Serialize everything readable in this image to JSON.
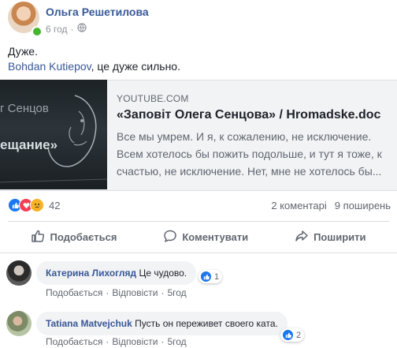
{
  "post": {
    "author": "Ольга Решетилова",
    "time": "6 год",
    "line1": "Дуже.",
    "mention": "Bohdan Kutiepov",
    "line2_rest": ", це дуже сильно."
  },
  "link_card": {
    "source": "YOUTUBE.COM",
    "title": "«Заповіт Олега Сенцова» / Hromadske.doc",
    "description": "Все мы умрем. И я, к сожалению, не исключение. Всем хотелось бы пожить подольше, и тут я тоже, к счастью, не исключение. Нет, мне не хотелось бы...",
    "thumb_line1": "г Сенцов",
    "thumb_line2": "ещание»"
  },
  "reactions": {
    "count": "42",
    "comments": "2 коментарі",
    "shares": "9 поширень",
    "icons": [
      "like-icon",
      "love-icon",
      "sad-icon"
    ]
  },
  "actions": {
    "like": "Подобається",
    "comment": "Коментувати",
    "share": "Поширити"
  },
  "comments": [
    {
      "name": "Катерина Лихогляд",
      "text": "Це чудово.",
      "reactions": "1",
      "like": "Подобається",
      "reply": "Відповісти",
      "dot": "·",
      "time": "5год"
    },
    {
      "name": "Tatiana Matvejchuk",
      "text": "Пусть он переживет своего ката.",
      "reactions": "2",
      "like": "Подобається",
      "reply": "Відповісти",
      "dot": "·",
      "time": "5год"
    }
  ],
  "colors": {
    "link": "#385898",
    "like_blue": "#1877f2",
    "love_red": "#f33e58",
    "sad_yellow": "#f7b125",
    "online_green": "#42b72a"
  }
}
